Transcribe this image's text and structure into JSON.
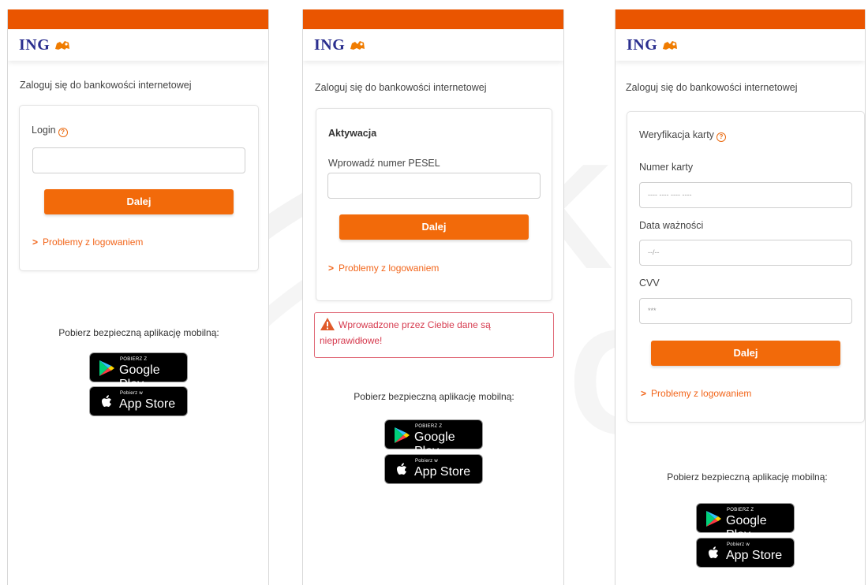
{
  "brand": {
    "name": "ING",
    "accent": "#ea5500",
    "button_color": "#f26a0a",
    "link_color": "#f2651a",
    "error_color": "#d63b4f"
  },
  "screens": [
    {
      "title": "Zaloguj się do bankowości internetowej",
      "login_label": "Login",
      "button_label": "Dalej",
      "problems_link": "Problemy z logowaniem",
      "promo_text": "Pobierz bezpieczną aplikację mobilną:"
    },
    {
      "title": "Zaloguj się do bankowości internetowej",
      "section_heading": "Aktywacja",
      "pesel_label": "Wprowadź numer PESEL",
      "button_label": "Dalej",
      "problems_link": "Problemy z logowaniem",
      "error_message": "Wprowadzone przez Ciebie dane są nieprawidłowe!",
      "promo_text": "Pobierz bezpieczną aplikację mobilną:"
    },
    {
      "title": "Zaloguj się do bankowości internetowej",
      "section_heading": "Weryfikacja karty",
      "card_number_label": "Numer karty",
      "card_number_placeholder": "---- ---- ---- ----",
      "expiry_label": "Data ważności",
      "expiry_placeholder": "--/--",
      "cvv_label": "CVV",
      "cvv_placeholder": "***",
      "button_label": "Dalej",
      "problems_link": "Problemy z logowaniem",
      "promo_text": "Pobierz bezpieczną aplikację mobilną:"
    }
  ],
  "badges": {
    "google_small": "POBIERZ Z",
    "google_big": "Google Play",
    "apple_small": "Pobierz w",
    "apple_big": "App Store"
  },
  "icons": [
    "ing-lion-icon",
    "info-icon",
    "chevron-right-icon",
    "warning-icon",
    "google-play-icon",
    "apple-icon"
  ]
}
